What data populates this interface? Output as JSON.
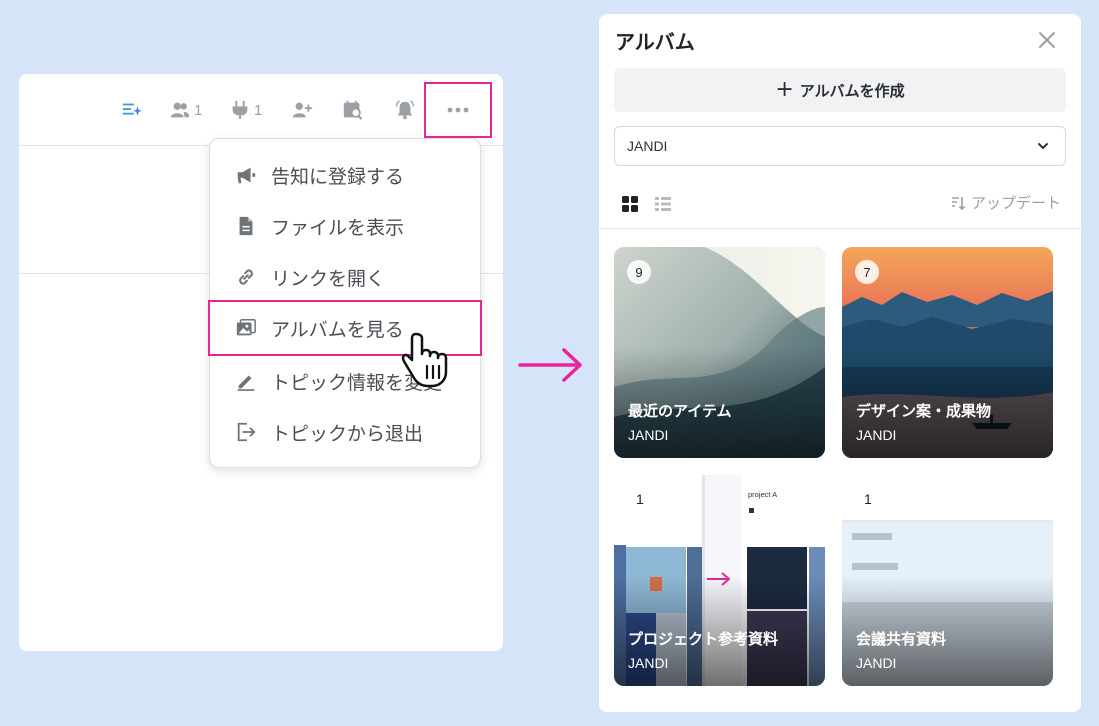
{
  "toolbar": {
    "members_count": "1",
    "connections_count": "1"
  },
  "menu": {
    "items": [
      {
        "label": "告知に登録する",
        "icon": "megaphone-icon"
      },
      {
        "label": "ファイルを表示",
        "icon": "file-icon"
      },
      {
        "label": "リンクを開く",
        "icon": "link-icon"
      },
      {
        "label": "アルバムを見る",
        "icon": "album-icon"
      },
      {
        "label": "トピック情報を変更",
        "icon": "pencil-icon"
      },
      {
        "label": "トピックから退出",
        "icon": "exit-icon"
      }
    ]
  },
  "album_panel": {
    "title": "アルバム",
    "create_label": "アルバムを作成",
    "select_value": "JANDI",
    "sort_label": "アップデート",
    "albums": [
      {
        "name": "最近のアイテム",
        "owner": "JANDI",
        "count": "9"
      },
      {
        "name": "デザイン案・成果物",
        "owner": "JANDI",
        "count": "7"
      },
      {
        "name": "プロジェクト参考資料",
        "owner": "JANDI",
        "count": "1"
      },
      {
        "name": "会議共有資料",
        "owner": "JANDI",
        "count": "1"
      }
    ]
  },
  "colors": {
    "highlight": "#e7259b",
    "background": "#d5e4f8"
  }
}
